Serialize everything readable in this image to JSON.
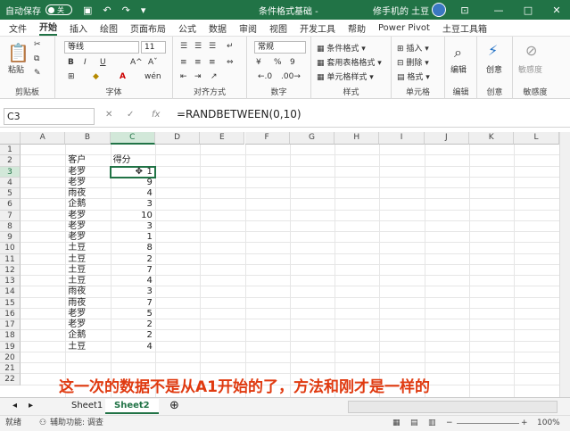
{
  "titlebar": {
    "autosave_label": "自动保存",
    "autosave_state": "关",
    "doc_title": "条件格式基础 -",
    "user_name": "修手机的 土豆",
    "minimize": "—",
    "restore": "□",
    "close": "✕",
    "save_icon": "save-icon",
    "undo_icon": "undo-icon",
    "redo_icon": "redo-icon"
  },
  "menu": {
    "items": [
      "文件",
      "开始",
      "插入",
      "绘图",
      "页面布局",
      "公式",
      "数据",
      "审阅",
      "视图",
      "开发工具",
      "帮助",
      "Power Pivot",
      "土豆工具箱"
    ],
    "active": "开始"
  },
  "ribbon": {
    "clipboard": {
      "label": "剪贴板",
      "paste": "粘贴"
    },
    "font": {
      "label": "字体",
      "name": "等线",
      "size": "11",
      "bold": "B",
      "italic": "I",
      "underline": "U",
      "grow": "A^",
      "shrink": "Aˇ",
      "fontcolor": "A",
      "phonetic": "wén"
    },
    "alignment": {
      "label": "对齐方式"
    },
    "number": {
      "label": "数字",
      "format": "常规",
      "percent": "%",
      "comma": "9",
      "currency": "¥"
    },
    "styles": {
      "label": "样式",
      "conditional": "条件格式 ▾",
      "table": "套用表格格式 ▾",
      "cellstyle": "单元格样式 ▾"
    },
    "cells": {
      "label": "单元格",
      "insert": "插入 ▾",
      "delete": "删除 ▾",
      "format": "格式 ▾"
    },
    "editing": {
      "label": "编辑",
      "text": "编辑"
    },
    "create": {
      "label": "创意",
      "text": "创意"
    },
    "sensitivity": {
      "label": "敏感度",
      "text": "敏感度"
    }
  },
  "formulabar": {
    "namebox": "C3",
    "cancel": "✕",
    "enter": "✓",
    "fx": "fx",
    "formula": "=RANDBETWEEN(0,10)"
  },
  "grid": {
    "columns": [
      "A",
      "B",
      "C",
      "D",
      "E",
      "F",
      "G",
      "H",
      "I",
      "J",
      "K",
      "L"
    ],
    "rows": [
      "1",
      "2",
      "3",
      "4",
      "5",
      "6",
      "7",
      "8",
      "9",
      "10",
      "11",
      "12",
      "13",
      "14",
      "15",
      "16",
      "17",
      "18",
      "19",
      "20",
      "21",
      "22"
    ],
    "selected_col": "C",
    "selected_row": "3",
    "header_customer": "客户",
    "header_score": "得分",
    "data": [
      {
        "name": "老罗",
        "score": "1"
      },
      {
        "name": "老罗",
        "score": "9"
      },
      {
        "name": "雨夜",
        "score": "4"
      },
      {
        "name": "企鹅",
        "score": "3"
      },
      {
        "name": "老罗",
        "score": "10"
      },
      {
        "name": "老罗",
        "score": "3"
      },
      {
        "name": "老罗",
        "score": "1"
      },
      {
        "name": "土豆",
        "score": "8"
      },
      {
        "name": "土豆",
        "score": "2"
      },
      {
        "name": "土豆",
        "score": "7"
      },
      {
        "name": "土豆",
        "score": "4"
      },
      {
        "name": "雨夜",
        "score": "3"
      },
      {
        "name": "雨夜",
        "score": "7"
      },
      {
        "name": "老罗",
        "score": "5"
      },
      {
        "name": "老罗",
        "score": "2"
      },
      {
        "name": "企鹅",
        "score": "2"
      },
      {
        "name": "土豆",
        "score": "4"
      }
    ]
  },
  "caption": "这一次的数据不是从A1开始的了，方法和刚才是一样的",
  "sheets": {
    "tabs": [
      "Sheet1",
      "Sheet2"
    ],
    "active": "Sheet2",
    "add": "⊕"
  },
  "status": {
    "ready": "就绪",
    "accessibility": "辅助功能: 调查",
    "zoom": "100%"
  },
  "colors": {
    "accent": "#217346",
    "caption": "#e03a10"
  }
}
